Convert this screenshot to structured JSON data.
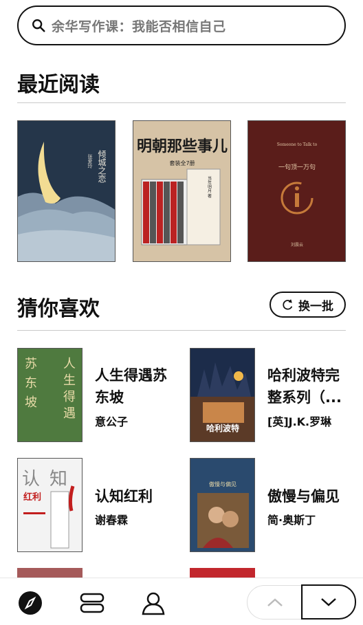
{
  "search": {
    "placeholder_text": "余华写作课：我能否相信自己"
  },
  "recent": {
    "title": "最近阅读",
    "books": [
      {
        "cover_title": "倾城之恋",
        "cover_author": "张爱玲"
      },
      {
        "cover_title": "明朝那些事儿",
        "cover_subtitle": "套装全7册",
        "cover_author": "当年明月 著"
      },
      {
        "cover_title": "一句顶一万句",
        "cover_en": "Someone to Talk to",
        "cover_author": "刘震云"
      }
    ]
  },
  "recommend": {
    "title": "猜你喜欢",
    "refresh_label": "换一批",
    "items": [
      {
        "title_line1": "人生得遇苏",
        "title_line2": "东坡",
        "author": "意公子",
        "cover_text": "人生得遇 苏东坡"
      },
      {
        "title_line1": "哈利波特完",
        "title_line2": "整系列（...",
        "author": "[英]J.K.罗琳",
        "cover_text": "哈利波特"
      },
      {
        "title_line1": "认知红利",
        "title_line2": "",
        "author": "谢春霖",
        "cover_text": "认知红利"
      },
      {
        "title_line1": "傲慢与偏见",
        "title_line2": "",
        "author": "简·奥斯丁",
        "cover_text": "傲慢与偏见"
      }
    ]
  },
  "nav": {
    "tabs": [
      "discover-icon",
      "bookshelf-icon",
      "profile-icon"
    ],
    "pager": [
      "chevron-up-icon",
      "chevron-down-icon"
    ]
  }
}
